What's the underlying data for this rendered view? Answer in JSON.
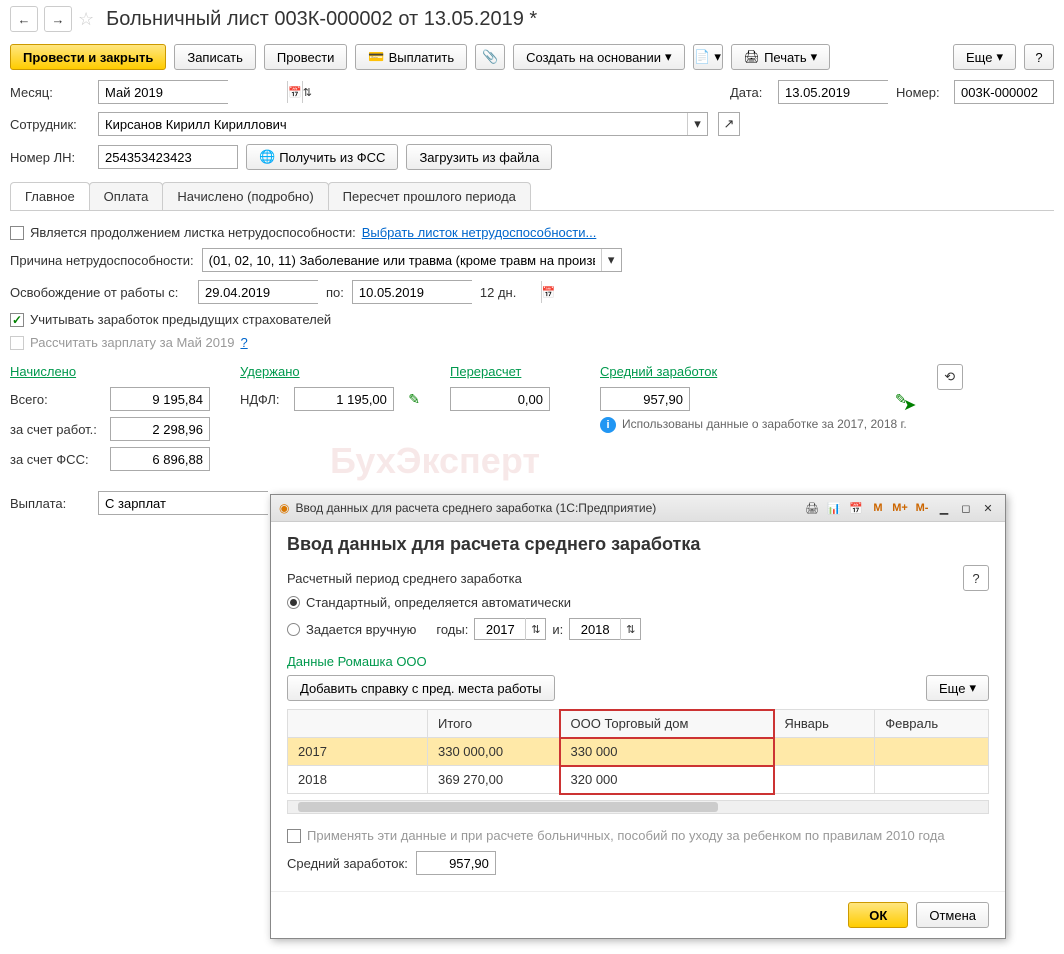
{
  "header": {
    "back": "←",
    "forward": "→",
    "star": "☆",
    "title": "Больничный лист 003К-000002 от 13.05.2019 *"
  },
  "toolbar": {
    "post_close": "Провести и закрыть",
    "save": "Записать",
    "post": "Провести",
    "pay": "Выплатить",
    "create_based": "Создать на основании",
    "print": "Печать",
    "more": "Еще",
    "help": "?"
  },
  "fields": {
    "month_label": "Месяц:",
    "month_value": "Май 2019",
    "date_label": "Дата:",
    "date_value": "13.05.2019",
    "number_label": "Номер:",
    "number_value": "003К-000002",
    "employee_label": "Сотрудник:",
    "employee_value": "Кирсанов Кирилл Кириллович",
    "ln_label": "Номер ЛН:",
    "ln_value": "254353423423",
    "get_fss": "Получить из ФСС",
    "load_file": "Загрузить из файла"
  },
  "tabs": {
    "main": "Главное",
    "payment": "Оплата",
    "accrued": "Начислено (подробно)",
    "recalc": "Пересчет прошлого периода"
  },
  "main_tab": {
    "continuation": "Является продолжением листка нетрудоспособности:",
    "select_prev": "Выбрать листок нетрудоспособности...",
    "reason_label": "Причина нетрудоспособности:",
    "reason_value": "(01, 02, 10, 11) Заболевание или травма (кроме травм на произв",
    "release_label": "Освобождение от работы с:",
    "release_from": "29.04.2019",
    "release_to_label": "по:",
    "release_to": "10.05.2019",
    "days": "12 дн.",
    "prev_insurers": "Учитывать заработок предыдущих страхователей",
    "calc_salary": "Рассчитать зарплату за Май 2019",
    "calc_salary_help": "?"
  },
  "summary": {
    "accrued_header": "Начислено",
    "withheld_header": "Удержано",
    "recalc_header": "Перерасчет",
    "avg_header": "Средний заработок",
    "total_label": "Всего:",
    "total_value": "9 195,84",
    "employer_label": "за счет работ.:",
    "employer_value": "2 298,96",
    "fss_label": "за счет ФСС:",
    "fss_value": "6 896,88",
    "ndfl_label": "НДФЛ:",
    "ndfl_value": "1 195,00",
    "recalc_value": "0,00",
    "avg_value": "957,90",
    "info_text": "Использованы данные о заработке за 2017, 2018 г.",
    "payout_label": "Выплата:",
    "payout_value": "С зарплат"
  },
  "dialog": {
    "window_title": "Ввод данных для расчета среднего заработка  (1С:Предприятие)",
    "heading": "Ввод данных для расчета среднего заработка",
    "period_label": "Расчетный период среднего заработка",
    "help": "?",
    "radio_auto": "Стандартный, определяется автоматически",
    "radio_manual": "Задается вручную",
    "years_label": "годы:",
    "year1": "2017",
    "year_and": "и:",
    "year2": "2018",
    "company_data": "Данные Ромашка ООО",
    "add_ref": "Добавить справку с пред. места работы",
    "more": "Еще",
    "table": {
      "col_total": "Итого",
      "col_torg": "ООО Торговый дом",
      "col_jan": "Январь",
      "col_feb": "Февраль",
      "rows": [
        {
          "year": "2017",
          "total": "330 000,00",
          "torg": "330 000"
        },
        {
          "year": "2018",
          "total": "369 270,00",
          "torg": "320 000"
        }
      ]
    },
    "apply2010": "Применять эти данные и при расчете больничных, пособий по уходу за ребенком по правилам 2010 года",
    "avg_label": "Средний заработок:",
    "avg_value": "957,90",
    "ok": "ОК",
    "cancel": "Отмена",
    "mem_icons": [
      "M",
      "M+",
      "M-"
    ]
  }
}
